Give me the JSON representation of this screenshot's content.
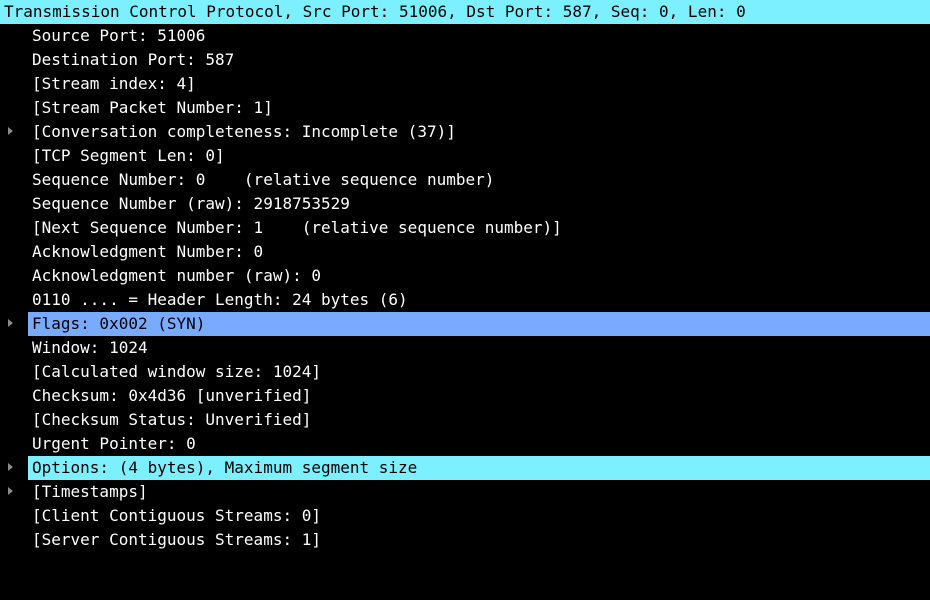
{
  "colors": {
    "background": "#000000",
    "text": "#ffffff",
    "highlight_cyan": "#7cf0ff",
    "selected_blue": "#78aaff",
    "expander": "#8a8a8a"
  },
  "tree": {
    "root": "Transmission Control Protocol, Src Port: 51006, Dst Port: 587, Seq: 0, Len: 0",
    "items": [
      "Source Port: 51006",
      "Destination Port: 587",
      "[Stream index: 4]",
      "[Stream Packet Number: 1]",
      "[Conversation completeness: Incomplete (37)]",
      "[TCP Segment Len: 0]",
      "Sequence Number: 0    (relative sequence number)",
      "Sequence Number (raw): 2918753529",
      "[Next Sequence Number: 1    (relative sequence number)]",
      "Acknowledgment Number: 0",
      "Acknowledgment number (raw): 0",
      "0110 .... = Header Length: 24 bytes (6)",
      "Flags: 0x002 (SYN)",
      "Window: 1024",
      "[Calculated window size: 1024]",
      "Checksum: 0x4d36 [unverified]",
      "[Checksum Status: Unverified]",
      "Urgent Pointer: 0",
      "Options: (4 bytes), Maximum segment size",
      "[Timestamps]",
      "[Client Contiguous Streams: 0]",
      "[Server Contiguous Streams: 1]"
    ]
  }
}
